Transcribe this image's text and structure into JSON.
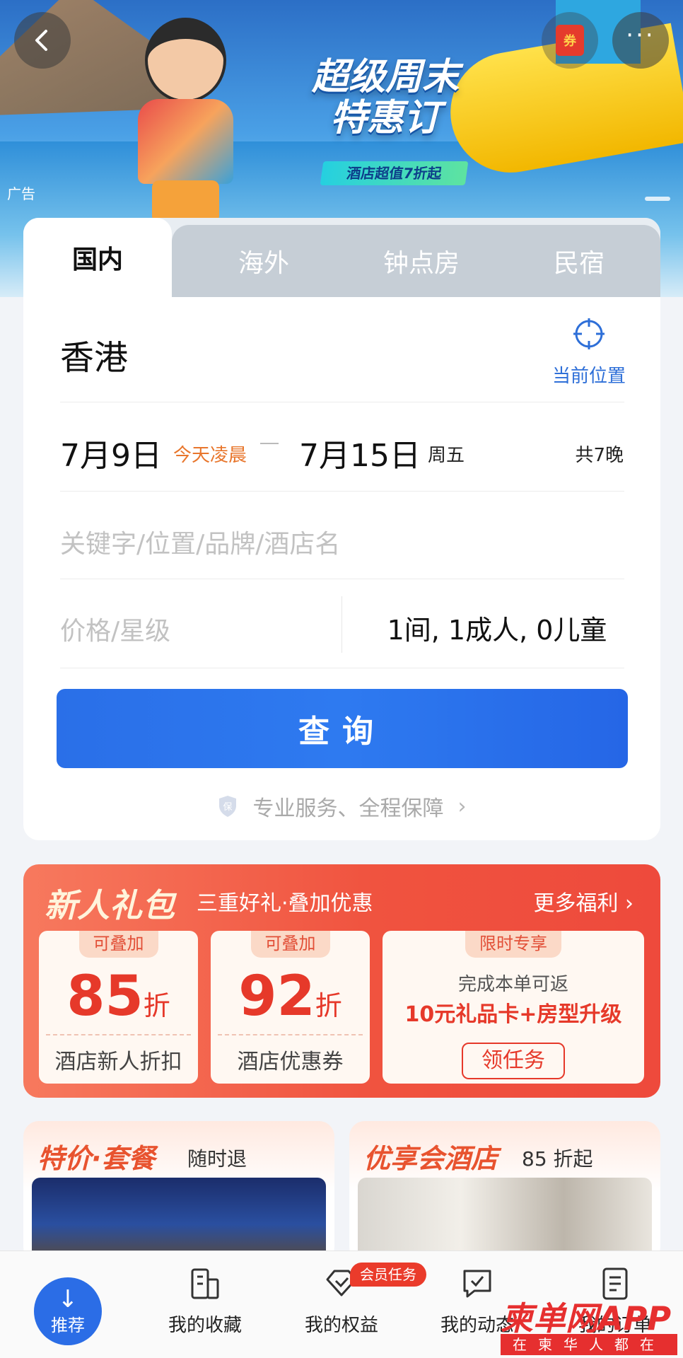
{
  "banner": {
    "headline_line1": "超级周末",
    "headline_line2": "特惠订",
    "tagline": "酒店超值7折起",
    "ad_label": "广告",
    "coupon_icon_text": "券"
  },
  "tabs": [
    "国内",
    "海外",
    "钟点房",
    "民宿"
  ],
  "search": {
    "city": "香港",
    "location_label": "当前位置",
    "checkin": "7月9日",
    "checkin_note": "今天凌晨",
    "checkout": "7月15日",
    "checkout_weekday": "周五",
    "nights": "共7晚",
    "keyword_placeholder": "关键字/位置/品牌/酒店名",
    "price_placeholder": "价格/星级",
    "guests": "1间, 1成人, 0儿童",
    "search_button": "查询",
    "guarantee": "专业服务、全程保障",
    "shield_icon_text": "保"
  },
  "gift": {
    "title": "新人礼包",
    "subtitle": "三重好礼·叠加优惠",
    "more": "更多福利",
    "cards": [
      {
        "badge": "可叠加",
        "value": "85",
        "unit": "折",
        "label": "酒店新人折扣"
      },
      {
        "badge": "可叠加",
        "value": "92",
        "unit": "折",
        "label": "酒店优惠券"
      },
      {
        "badge": "限时专享",
        "line1": "完成本单可返",
        "line2": "10元礼品卡+房型升级",
        "button": "领任务"
      }
    ]
  },
  "promos": [
    {
      "title": "特价·套餐",
      "subtitle": "随时退"
    },
    {
      "title": "优享会酒店",
      "subtitle": "85 折起"
    }
  ],
  "bottom_nav": {
    "home": "推荐",
    "items": [
      "我的收藏",
      "我的权益",
      "我的动态",
      "我的订单"
    ],
    "member_badge": "会员任务"
  },
  "watermark": {
    "title": "柬单网APP",
    "subtitle": "在柬华人都在用"
  },
  "colors": {
    "primary_blue": "#2b6de6",
    "accent_orange": "#e8762c",
    "gift_red": "#f0533f"
  }
}
